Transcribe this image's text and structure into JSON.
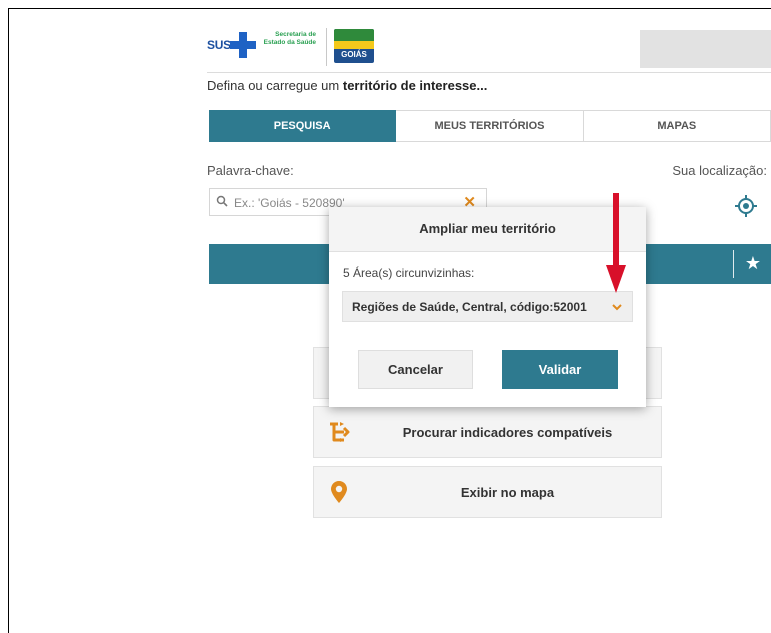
{
  "header": {
    "sus_logo_text": "SUS",
    "secretaria_text": "Secretaria de Estado da Saúde",
    "goias_logo_text": "GOIÁS"
  },
  "intro": {
    "prefix": "Defina ou carregue um ",
    "bold": "território de interesse..."
  },
  "tabs": [
    {
      "label": "PESQUISA",
      "active": true
    },
    {
      "label": "MEUS TERRITÓRIOS",
      "active": false
    },
    {
      "label": "MAPAS",
      "active": false
    }
  ],
  "search": {
    "label": "Palavra-chave:",
    "placeholder": "Ex.: 'Goiás - 520890'"
  },
  "location": {
    "label": "Sua localização:"
  },
  "actions": [
    {
      "label": "Procurar indicadores compatíveis",
      "icon": "flow-icon"
    },
    {
      "label": "Exibir no mapa",
      "icon": "map-pin-icon"
    }
  ],
  "modal": {
    "title": "Ampliar meu território",
    "info": "5 Área(s) circunvizinhas:",
    "selected": "Regiões de Saúde, Central, código:52001",
    "cancel_label": "Cancelar",
    "validate_label": "Validar"
  },
  "colors": {
    "accent": "#2e7a8f",
    "icon_orange": "#e08a1e",
    "arrow_red": "#d8102a"
  }
}
